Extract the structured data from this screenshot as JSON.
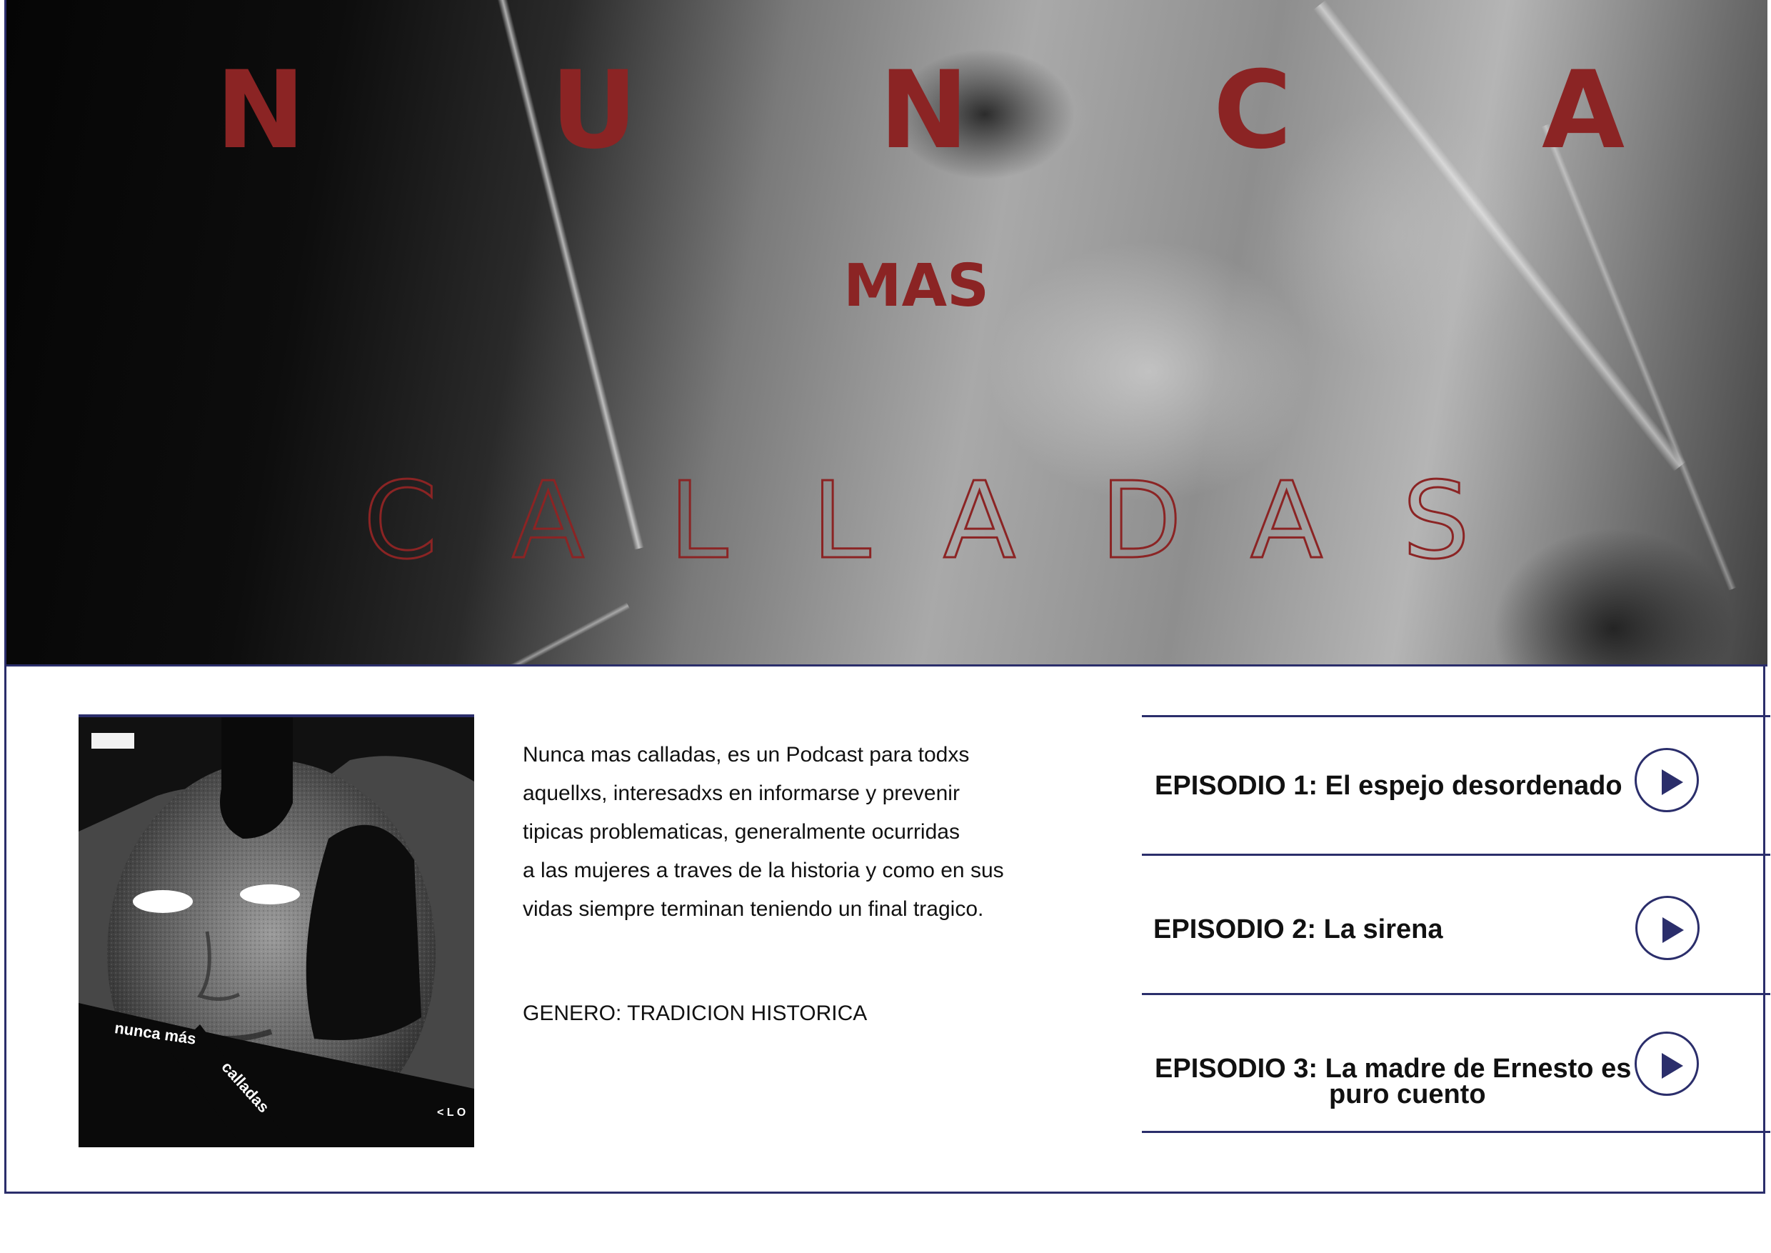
{
  "hero": {
    "title_letters": [
      "N",
      "U",
      "N",
      "C",
      "A"
    ],
    "subtitle": "MAS",
    "outline_letters": [
      "C",
      "A",
      "L",
      "L",
      "A",
      "D",
      "A",
      "S"
    ]
  },
  "cover": {
    "caption_line1": "nunca más",
    "caption_line2": "calladas",
    "corner_text": "< L O"
  },
  "description": {
    "lines": [
      "Nunca mas calladas, es un Podcast para todxs",
      "aquellxs, interesadxs en informarse y prevenir",
      "tipicas problematicas, generalmente ocurridas",
      "a las mujeres a traves de la historia y como en sus",
      "vidas siempre terminan teniendo un final tragico."
    ],
    "genre": "GENERO: TRADICION HISTORICA"
  },
  "episodes": [
    {
      "label": "EPISODIO 1: El espejo desordenado"
    },
    {
      "label": "EPISODIO 2: La sirena"
    },
    {
      "label_line1": "EPISODIO 3: La madre de Ernesto es",
      "label_line2": "puro cuento"
    }
  ],
  "icons": {
    "play": "play-icon"
  },
  "colors": {
    "title_red": "#8b2424",
    "accent_navy": "#2b2e6b"
  }
}
